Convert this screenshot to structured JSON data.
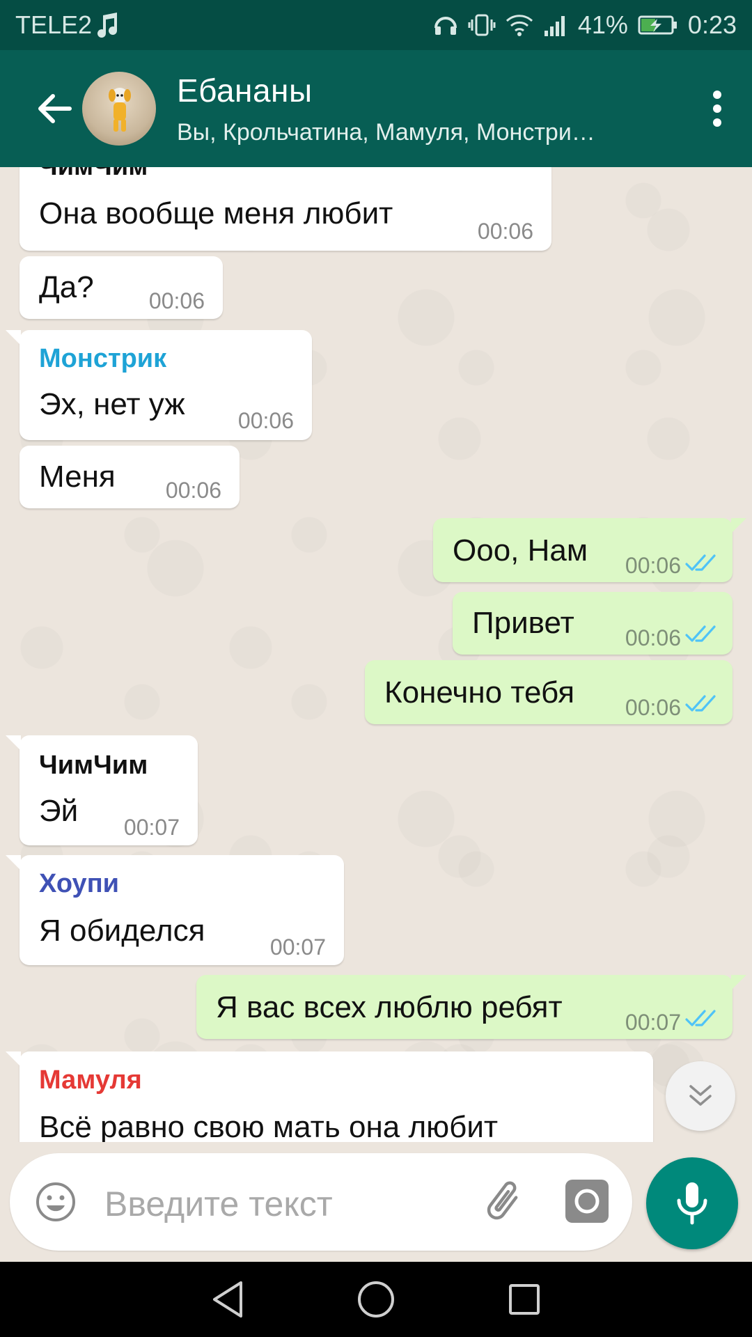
{
  "status_bar": {
    "carrier": "TELE2",
    "battery_percent": "41%",
    "time": "0:23"
  },
  "header": {
    "title": "Ебананы",
    "subtitle": "Вы, Крольчатина, Мамуля, Монстри…"
  },
  "messages": [
    {
      "dir": "in",
      "sender": "ЧимЧим",
      "text": "Она вообще меня любит",
      "time": "00:06"
    },
    {
      "dir": "in",
      "sender": "",
      "text": "Да?",
      "time": "00:06"
    },
    {
      "dir": "in",
      "sender": "Монстрик",
      "sender_color": "#1ea3d6",
      "text": "Эх, нет уж",
      "time": "00:06"
    },
    {
      "dir": "in",
      "sender": "",
      "text": "Меня",
      "time": "00:06"
    },
    {
      "dir": "out",
      "text": "Ооо, Нам",
      "time": "00:06",
      "status": "read"
    },
    {
      "dir": "out",
      "text": "Привет",
      "time": "00:06",
      "status": "read"
    },
    {
      "dir": "out",
      "text": "Конечно тебя",
      "time": "00:06",
      "status": "read"
    },
    {
      "dir": "in",
      "sender": "ЧимЧим",
      "sender_color": "#111111",
      "text": "Эй",
      "time": "00:07"
    },
    {
      "dir": "in",
      "sender": "Хоупи",
      "sender_color": "#3f51b5",
      "text": "Я обиделся",
      "time": "00:07"
    },
    {
      "dir": "out",
      "text": "Я вас всех люблю ребят",
      "time": "00:07",
      "status": "read"
    },
    {
      "dir": "in",
      "sender": "Мамуля",
      "sender_color": "#e53935",
      "text": "Всё равно свою мать она любит",
      "time": ""
    }
  ],
  "input": {
    "placeholder": "Введите текст"
  },
  "colors": {
    "header": "#075e54",
    "status_bar": "#054d44",
    "outgoing_bubble": "#dcf8c6",
    "incoming_bubble": "#ffffff",
    "read_ticks": "#4fc3f7",
    "mic_button": "#00897b"
  },
  "icons": {
    "back": "arrow-left-icon",
    "menu": "more-vert-icon",
    "emoji": "smiley-icon",
    "attach": "paperclip-icon",
    "camera": "camera-icon",
    "mic": "microphone-icon",
    "scroll_down": "double-chevron-down-icon"
  }
}
